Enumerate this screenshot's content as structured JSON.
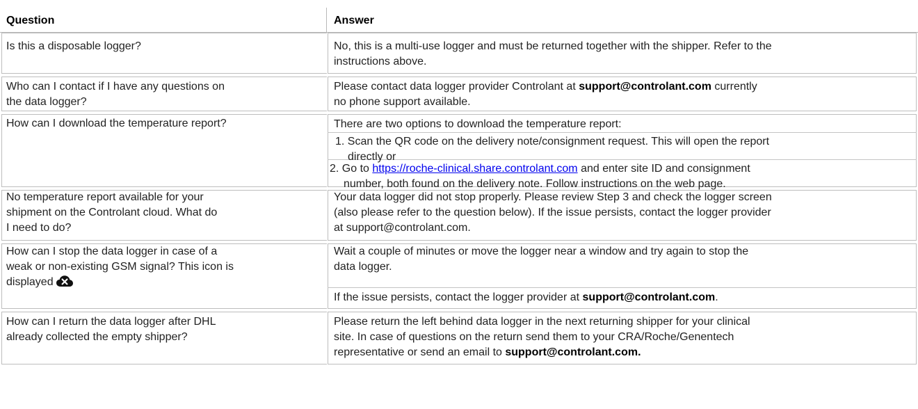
{
  "table": {
    "headers": {
      "question": "Question",
      "answer": "Answer"
    },
    "rows": [
      {
        "question": [
          "Is this a disposable logger?"
        ],
        "answer": [
          "No, this is a multi-use logger and must be returned together with the shipper. Refer to the",
          "instructions above."
        ]
      },
      {
        "question": [
          "Who can I contact if I have any questions on",
          "the data logger?"
        ],
        "answer_pre": "Please contact data logger provider Controlant at ",
        "answer_email": "support@controlant.com",
        "answer_post": " currently",
        "answer_line2": "no phone support available."
      },
      {
        "question": [
          "How can I download the temperature report?"
        ],
        "answer_intro": "There are two options to download the temperature report:",
        "option1": [
          "1. Scan the QR code on the delivery note/consignment request. This will open the report",
          "directly or"
        ],
        "option2_pre": "2. Go to ",
        "option2_link": "https://roche-clinical.share.controlant.com",
        "option2_post": "  and enter site ID and consignment",
        "option2_line2": "number, both found on the delivery note. Follow instructions on the web page."
      },
      {
        "question": [
          "No temperature report available for your",
          "shipment on the Controlant cloud. What do",
          "I need to do?"
        ],
        "answer": [
          "Your data logger did not stop properly. Please review Step 3 and check the logger screen",
          "(also please refer to the question below). If the issue persists, contact the logger provider",
          "at support@controlant.com."
        ]
      },
      {
        "question": [
          "How can I stop the data logger in case of a",
          "weak or non-existing GSM signal? This icon is"
        ],
        "question_last": "displayed",
        "icon": "cloud-x-icon",
        "answer": [
          "Wait a couple of minutes or move the logger near a window and try again to stop the",
          "data logger."
        ],
        "answer_extra_pre": "If the issue persists, contact the logger provider at ",
        "answer_extra_email": "support@controlant.com",
        "answer_extra_post": "."
      },
      {
        "question": [
          "How can I return the data logger after DHL",
          "already collected the empty shipper?"
        ],
        "answer": [
          "Please return the left behind data logger in the next returning shipper for your clinical",
          "site. In case of questions on the return send them to your CRA/Roche/Genentech"
        ],
        "answer_last_pre": "representative or send an email to ",
        "answer_last_email": "support@controlant.com."
      }
    ]
  }
}
